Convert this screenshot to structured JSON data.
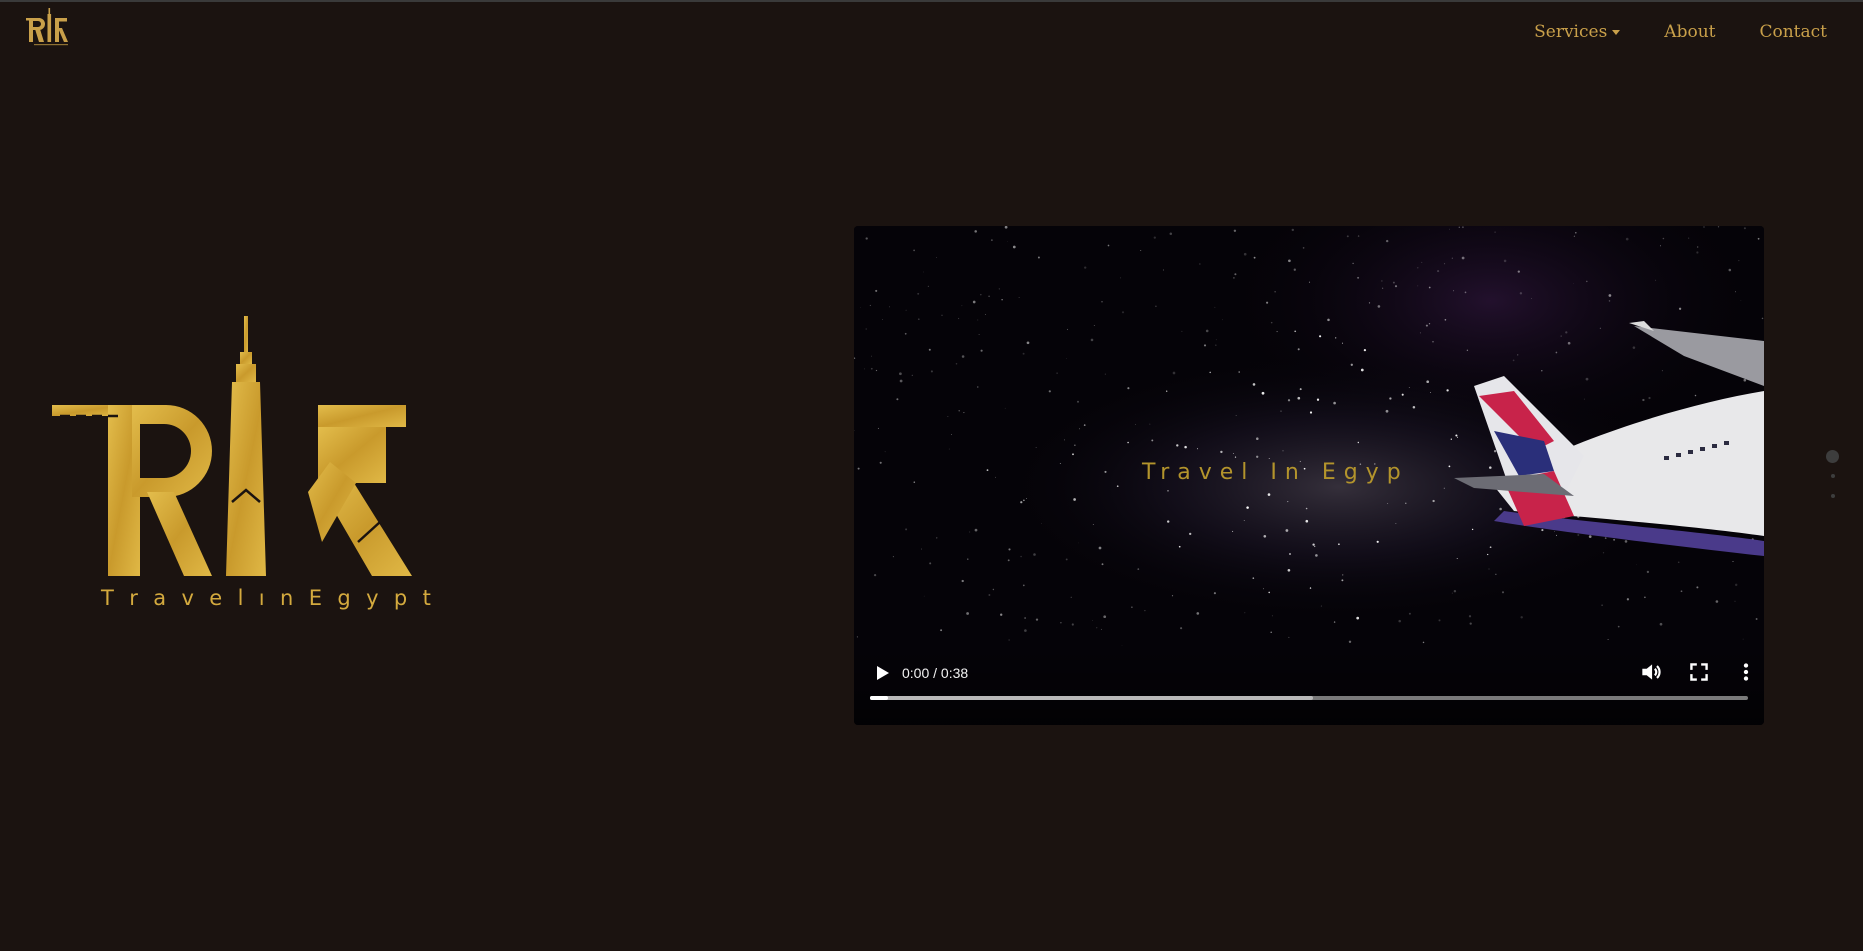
{
  "colors": {
    "background": "#1b1310",
    "accent_gold": "#c9a04a",
    "logo_gold": "#d4aa3e"
  },
  "navbar": {
    "brand_icon": "trf-logo-icon",
    "items": [
      {
        "label": "Services",
        "has_dropdown": true,
        "icon": "caret-down-icon"
      },
      {
        "label": "About"
      },
      {
        "label": "Contact"
      }
    ]
  },
  "hero": {
    "logo_icon": "travel-in-egypt-logo",
    "tagline_letters": [
      "T",
      "r",
      "a",
      "v",
      "e",
      "l",
      "ı",
      "n",
      "E",
      "g",
      "y",
      "p",
      "t"
    ]
  },
  "video": {
    "title_overlay": "Travel In Egyp",
    "time_display": "0:00 / 0:38",
    "played_fraction": 0.02,
    "buffered_fraction": 0.505,
    "icons": [
      "play-icon",
      "volume-icon",
      "fullscreen-icon",
      "more-options-icon"
    ]
  },
  "pagination_dots": {
    "count": 3,
    "active_index": 0
  }
}
